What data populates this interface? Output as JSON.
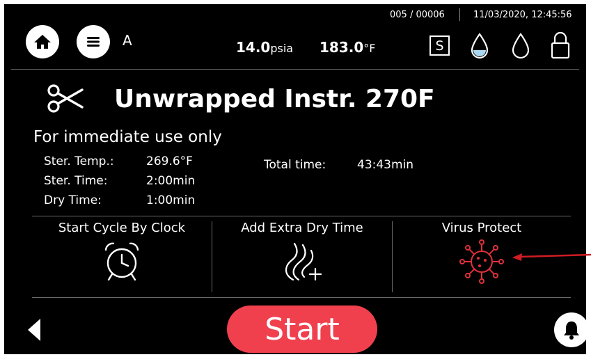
{
  "header": {
    "counter": "005 / 00006",
    "datetime": "11/03/2020, 12:45:56",
    "profile_letter": "A",
    "pressure_value": "14.0",
    "pressure_unit": "psia",
    "temperature_value": "183.0",
    "temperature_unit": "°F",
    "mode_badge": "S"
  },
  "icons": {
    "home": "home-icon",
    "menu": "menu-icon",
    "water_full": "water-drop-filled-icon",
    "water_empty": "water-drop-outline-icon",
    "lock": "lock-icon",
    "program": "scissors-icon",
    "clock": "alarm-clock-icon",
    "dry": "steam-plus-icon",
    "virus": "virus-icon",
    "back": "back-arrow-icon",
    "bell": "bell-icon"
  },
  "program": {
    "title": "Unwrapped Instr. 270F",
    "subtitle": "For immediate use only",
    "params": [
      {
        "label": "Ster. Temp.:",
        "value": "269.6°F"
      },
      {
        "label": "Ster. Time:",
        "value": "2:00min"
      },
      {
        "label": "Dry Time:",
        "value": "1:00min"
      }
    ],
    "total_label": "Total time:",
    "total_value": "43:43min"
  },
  "options": [
    {
      "label": "Start Cycle By Clock"
    },
    {
      "label": "Add Extra Dry Time"
    },
    {
      "label": "Virus Protect"
    }
  ],
  "footer": {
    "start_label": "Start"
  },
  "colors": {
    "accent_red": "#f0404e",
    "virus_red": "#e0303a",
    "water_blue": "#a9d8f0",
    "background": "#000000"
  }
}
